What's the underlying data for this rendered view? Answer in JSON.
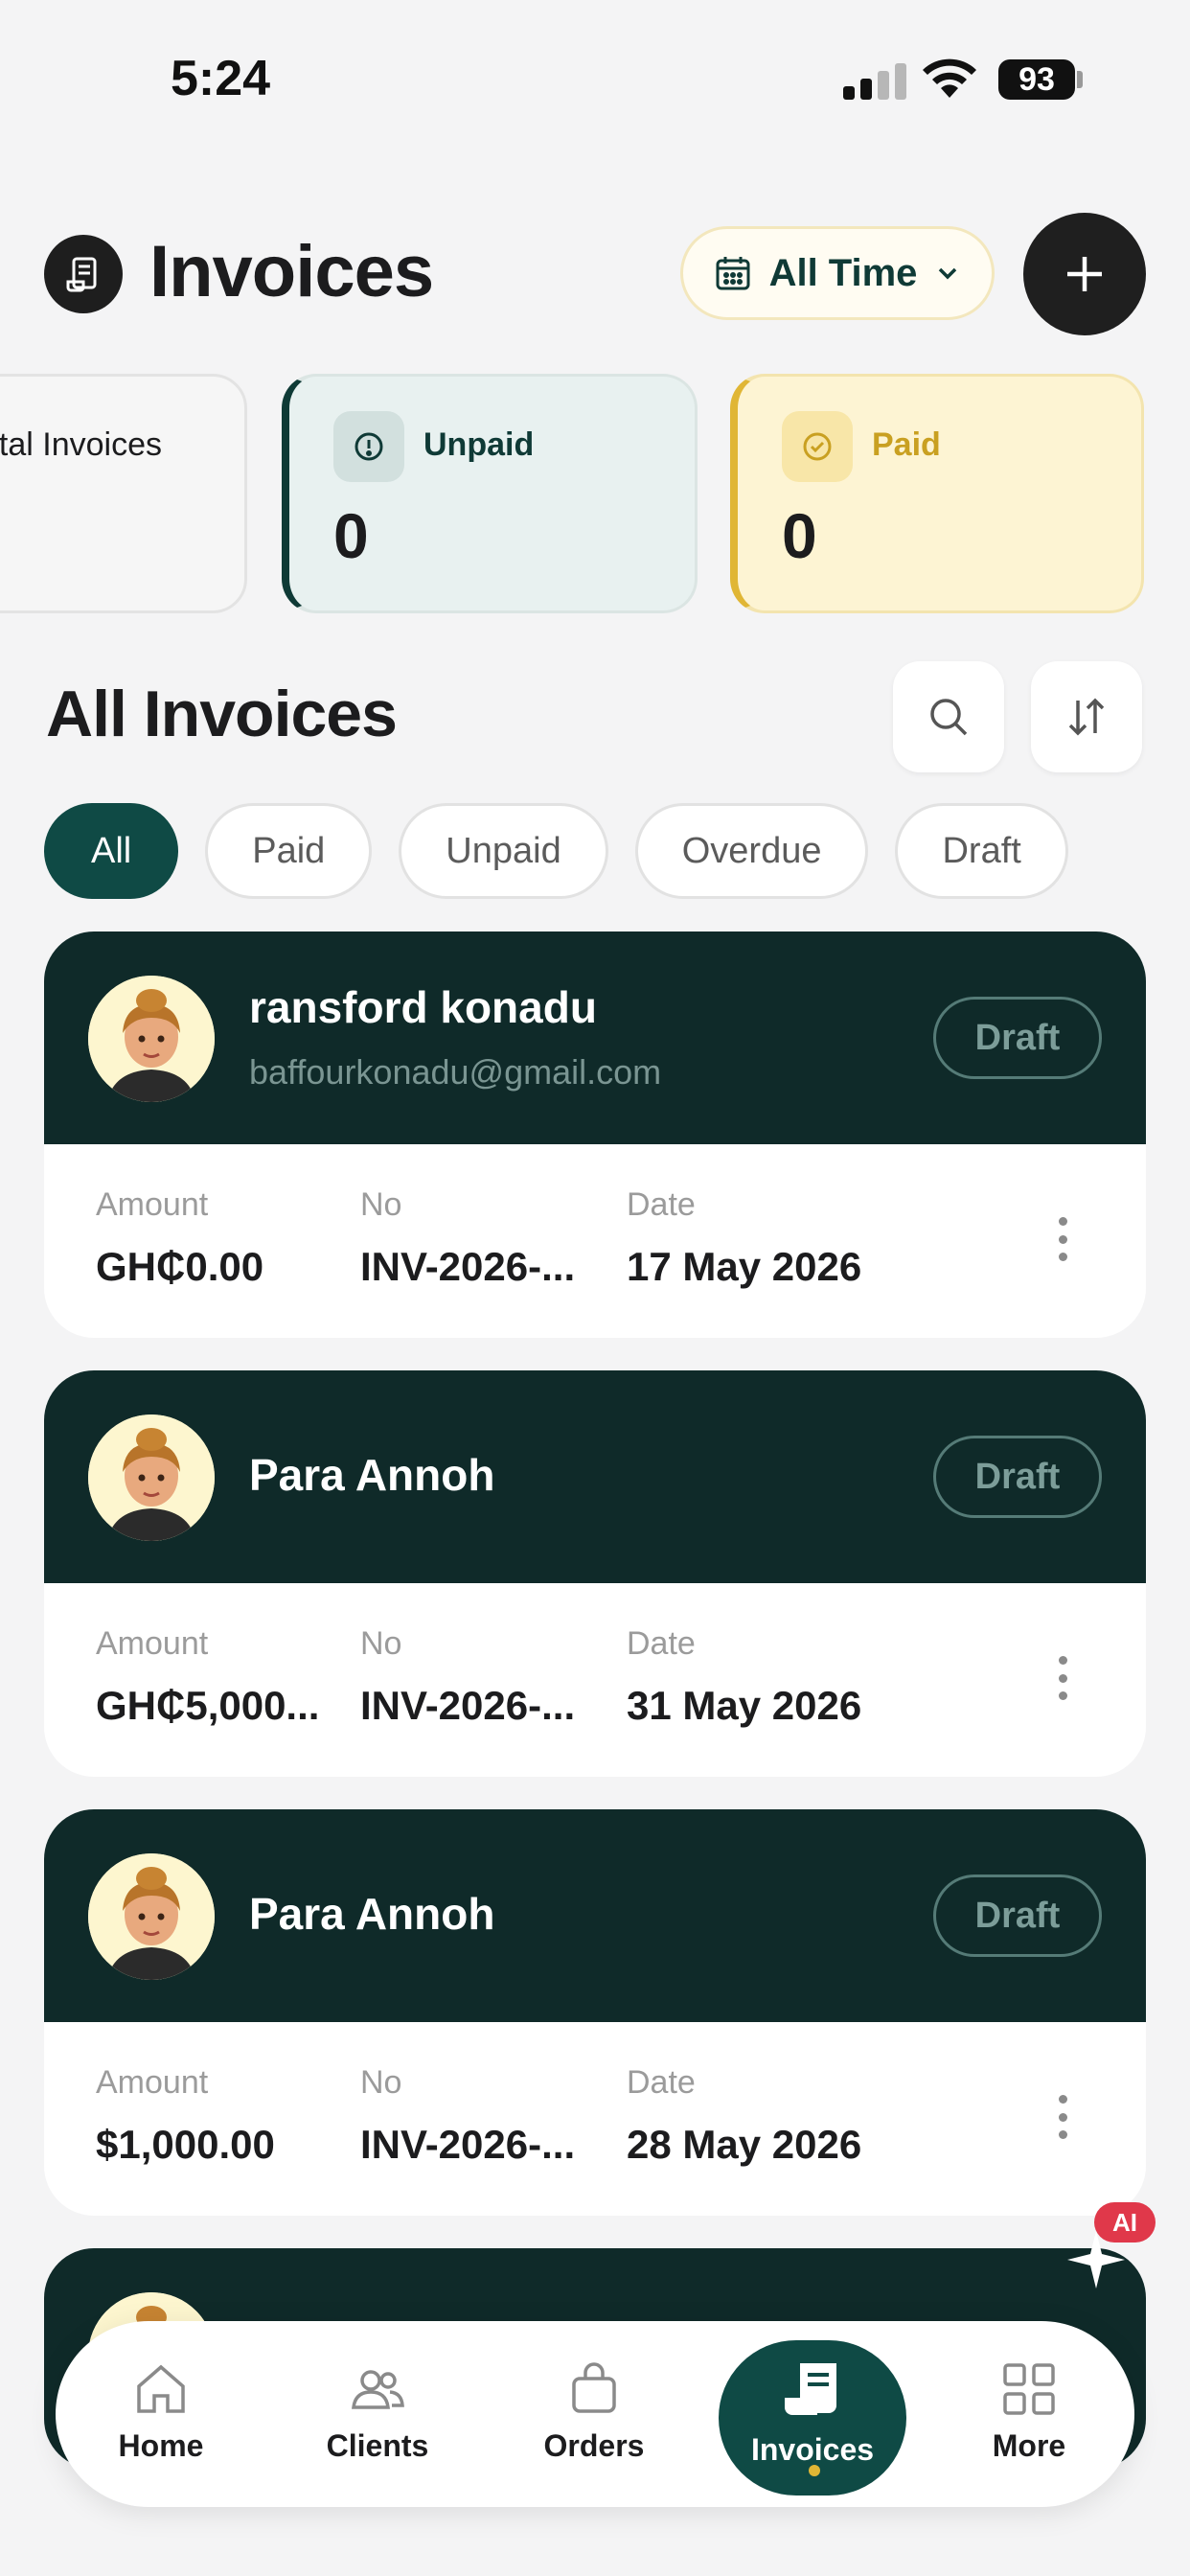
{
  "status_bar": {
    "time": "5:24",
    "battery": "93"
  },
  "header": {
    "title": "Invoices",
    "time_filter": "All Time"
  },
  "stats": [
    {
      "label": "Total Invoices",
      "value": ""
    },
    {
      "label": "Unpaid",
      "value": "0"
    },
    {
      "label": "Paid",
      "value": "0"
    }
  ],
  "section": {
    "title": "All Invoices"
  },
  "filters": [
    "All",
    "Paid",
    "Unpaid",
    "Overdue",
    "Draft"
  ],
  "field_labels": {
    "amount": "Amount",
    "no": "No",
    "date": "Date"
  },
  "invoices": [
    {
      "name": "ransford konadu",
      "email": "baffourkonadu@gmail.com",
      "status": "Draft",
      "amount": "GH₵0.00",
      "no": "INV-2026-...",
      "date": "17 May 2026"
    },
    {
      "name": "Para Annoh",
      "email": "",
      "status": "Draft",
      "amount": "GH₵5,000...",
      "no": "INV-2026-...",
      "date": "31 May 2026"
    },
    {
      "name": "Para Annoh",
      "email": "",
      "status": "Draft",
      "amount": "$1,000.00",
      "no": "INV-2026-...",
      "date": "28 May 2026"
    }
  ],
  "ai_badge": "AI",
  "nav": [
    {
      "label": "Home",
      "icon": "home-icon"
    },
    {
      "label": "Clients",
      "icon": "clients-icon"
    },
    {
      "label": "Orders",
      "icon": "bag-icon"
    },
    {
      "label": "Invoices",
      "icon": "invoice-icon"
    },
    {
      "label": "More",
      "icon": "grid-icon"
    }
  ],
  "colors": {
    "primary": "#0f4a45",
    "card_header": "#0f2a29",
    "accent_gold": "#e0b635",
    "ai_red": "#e0384a"
  }
}
